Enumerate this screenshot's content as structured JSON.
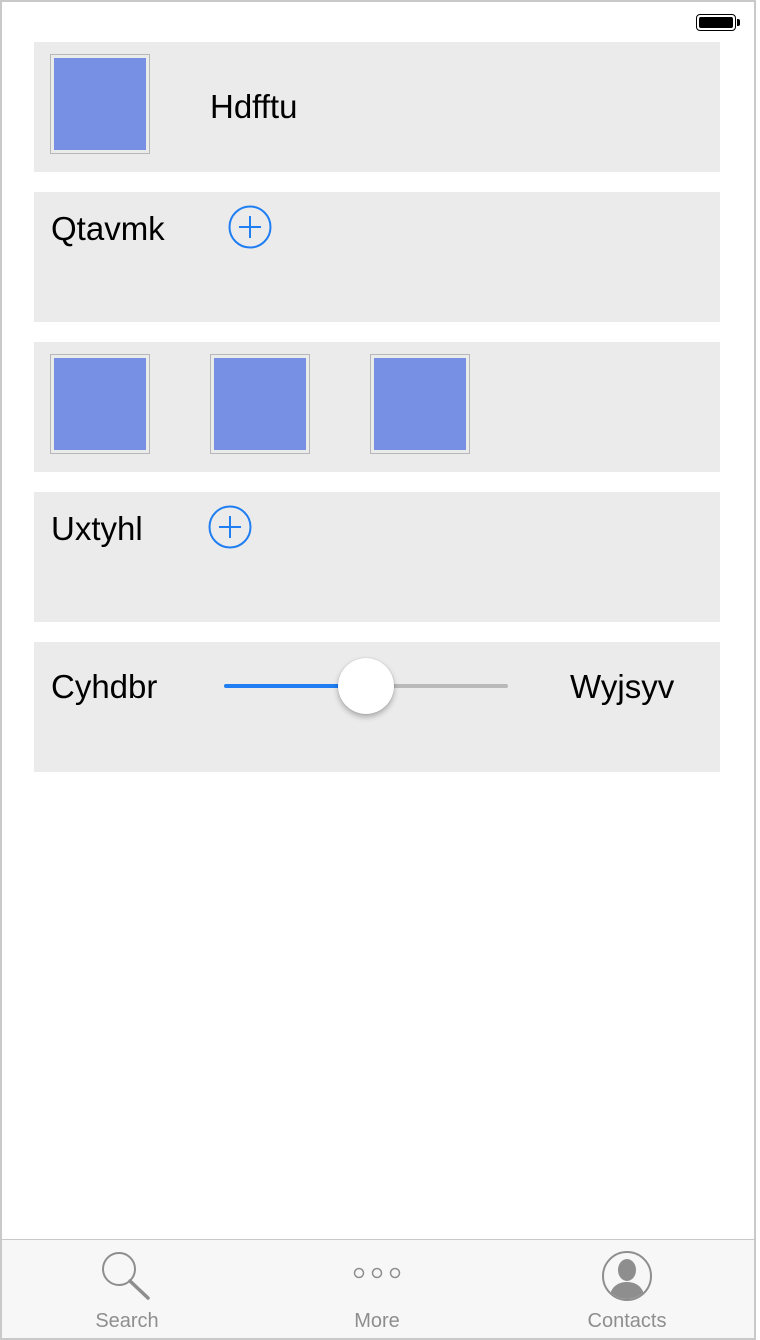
{
  "status_bar": {
    "battery_icon": "battery-full-icon"
  },
  "rows": {
    "row1": {
      "thumbnail_icon": "image-thumbnail",
      "label": "Hdfftu"
    },
    "row2": {
      "label": "Qtavmk",
      "add_icon": "plus-circle-icon"
    },
    "row3": {
      "thumbnails": [
        "image-thumbnail",
        "image-thumbnail",
        "image-thumbnail"
      ]
    },
    "row4": {
      "label": "Uxtyhl",
      "add_icon": "plus-circle-icon"
    },
    "row5": {
      "left_label": "Cyhdbr",
      "right_label": "Wyjsyv",
      "slider_value": 0.5
    }
  },
  "tab_bar": {
    "tabs": [
      {
        "label": "Search",
        "icon": "magnifier-icon"
      },
      {
        "label": "More",
        "icon": "more-dots-icon"
      },
      {
        "label": "Contacts",
        "icon": "contact-person-icon"
      }
    ]
  },
  "colors": {
    "accent": "#1e7ef2",
    "card_background": "#ebebeb",
    "thumbnail_fill": "#7890e4",
    "tab_label": "#8e8e8e"
  }
}
